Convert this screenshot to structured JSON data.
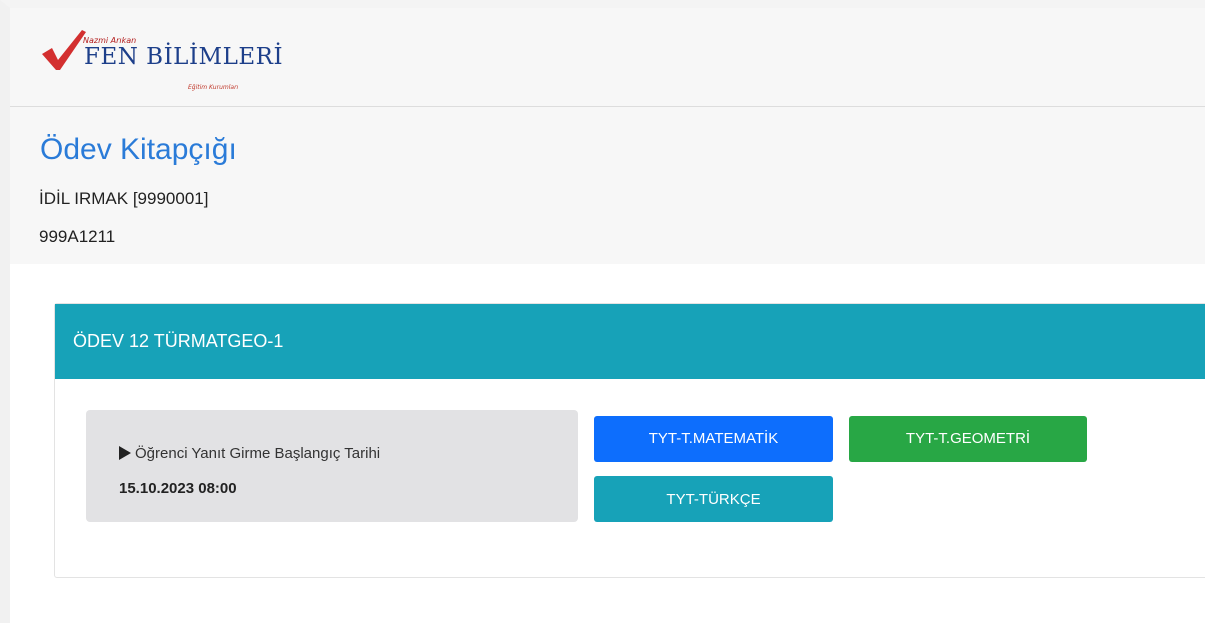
{
  "brand": {
    "small_text": "Nazmi Arıkan",
    "name": "FEN BİLİMLERİ",
    "subtitle": "Eğitim Kurumları",
    "logo_icon": "red-checkmark-icon",
    "logo_color": "#d32f2f",
    "name_color": "#1d3f8a"
  },
  "header": {
    "title": "Ödev Kitapçığı",
    "student": "İDİL IRMAK [9990001]",
    "code": "999A1211",
    "title_color": "#2a7bd8"
  },
  "card": {
    "title": "ÖDEV 12 TÜRMATGEO-1",
    "header_color": "#17a2b8",
    "info": {
      "icon": "play-icon",
      "label": "Öğrenci Yanıt Girme Başlangıç Tarihi",
      "date": "15.10.2023 08:00"
    },
    "buttons": {
      "matematik": {
        "label": "TYT-T.MATEMATİK",
        "color": "#0d6efd"
      },
      "geometri": {
        "label": "TYT-T.GEOMETRİ",
        "color": "#28a745"
      },
      "turkce": {
        "label": "TYT-TÜRKÇE",
        "color": "#17a2b8"
      }
    }
  }
}
